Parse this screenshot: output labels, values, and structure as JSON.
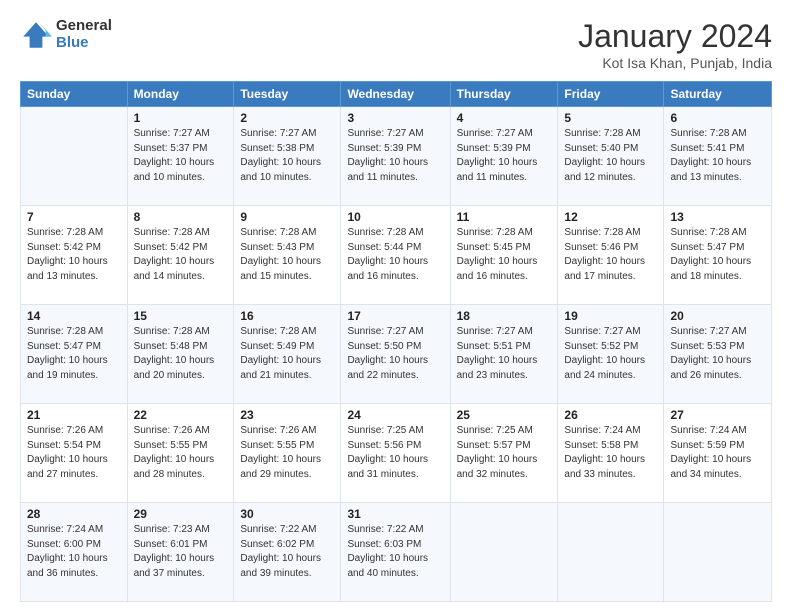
{
  "logo": {
    "general": "General",
    "blue": "Blue"
  },
  "header": {
    "month": "January 2024",
    "location": "Kot Isa Khan, Punjab, India"
  },
  "weekdays": [
    "Sunday",
    "Monday",
    "Tuesday",
    "Wednesday",
    "Thursday",
    "Friday",
    "Saturday"
  ],
  "weeks": [
    [
      {
        "day": "",
        "info": ""
      },
      {
        "day": "1",
        "info": "Sunrise: 7:27 AM\nSunset: 5:37 PM\nDaylight: 10 hours\nand 10 minutes."
      },
      {
        "day": "2",
        "info": "Sunrise: 7:27 AM\nSunset: 5:38 PM\nDaylight: 10 hours\nand 10 minutes."
      },
      {
        "day": "3",
        "info": "Sunrise: 7:27 AM\nSunset: 5:39 PM\nDaylight: 10 hours\nand 11 minutes."
      },
      {
        "day": "4",
        "info": "Sunrise: 7:27 AM\nSunset: 5:39 PM\nDaylight: 10 hours\nand 11 minutes."
      },
      {
        "day": "5",
        "info": "Sunrise: 7:28 AM\nSunset: 5:40 PM\nDaylight: 10 hours\nand 12 minutes."
      },
      {
        "day": "6",
        "info": "Sunrise: 7:28 AM\nSunset: 5:41 PM\nDaylight: 10 hours\nand 13 minutes."
      }
    ],
    [
      {
        "day": "7",
        "info": "Sunrise: 7:28 AM\nSunset: 5:42 PM\nDaylight: 10 hours\nand 13 minutes."
      },
      {
        "day": "8",
        "info": "Sunrise: 7:28 AM\nSunset: 5:42 PM\nDaylight: 10 hours\nand 14 minutes."
      },
      {
        "day": "9",
        "info": "Sunrise: 7:28 AM\nSunset: 5:43 PM\nDaylight: 10 hours\nand 15 minutes."
      },
      {
        "day": "10",
        "info": "Sunrise: 7:28 AM\nSunset: 5:44 PM\nDaylight: 10 hours\nand 16 minutes."
      },
      {
        "day": "11",
        "info": "Sunrise: 7:28 AM\nSunset: 5:45 PM\nDaylight: 10 hours\nand 16 minutes."
      },
      {
        "day": "12",
        "info": "Sunrise: 7:28 AM\nSunset: 5:46 PM\nDaylight: 10 hours\nand 17 minutes."
      },
      {
        "day": "13",
        "info": "Sunrise: 7:28 AM\nSunset: 5:47 PM\nDaylight: 10 hours\nand 18 minutes."
      }
    ],
    [
      {
        "day": "14",
        "info": "Sunrise: 7:28 AM\nSunset: 5:47 PM\nDaylight: 10 hours\nand 19 minutes."
      },
      {
        "day": "15",
        "info": "Sunrise: 7:28 AM\nSunset: 5:48 PM\nDaylight: 10 hours\nand 20 minutes."
      },
      {
        "day": "16",
        "info": "Sunrise: 7:28 AM\nSunset: 5:49 PM\nDaylight: 10 hours\nand 21 minutes."
      },
      {
        "day": "17",
        "info": "Sunrise: 7:27 AM\nSunset: 5:50 PM\nDaylight: 10 hours\nand 22 minutes."
      },
      {
        "day": "18",
        "info": "Sunrise: 7:27 AM\nSunset: 5:51 PM\nDaylight: 10 hours\nand 23 minutes."
      },
      {
        "day": "19",
        "info": "Sunrise: 7:27 AM\nSunset: 5:52 PM\nDaylight: 10 hours\nand 24 minutes."
      },
      {
        "day": "20",
        "info": "Sunrise: 7:27 AM\nSunset: 5:53 PM\nDaylight: 10 hours\nand 26 minutes."
      }
    ],
    [
      {
        "day": "21",
        "info": "Sunrise: 7:26 AM\nSunset: 5:54 PM\nDaylight: 10 hours\nand 27 minutes."
      },
      {
        "day": "22",
        "info": "Sunrise: 7:26 AM\nSunset: 5:55 PM\nDaylight: 10 hours\nand 28 minutes."
      },
      {
        "day": "23",
        "info": "Sunrise: 7:26 AM\nSunset: 5:55 PM\nDaylight: 10 hours\nand 29 minutes."
      },
      {
        "day": "24",
        "info": "Sunrise: 7:25 AM\nSunset: 5:56 PM\nDaylight: 10 hours\nand 31 minutes."
      },
      {
        "day": "25",
        "info": "Sunrise: 7:25 AM\nSunset: 5:57 PM\nDaylight: 10 hours\nand 32 minutes."
      },
      {
        "day": "26",
        "info": "Sunrise: 7:24 AM\nSunset: 5:58 PM\nDaylight: 10 hours\nand 33 minutes."
      },
      {
        "day": "27",
        "info": "Sunrise: 7:24 AM\nSunset: 5:59 PM\nDaylight: 10 hours\nand 34 minutes."
      }
    ],
    [
      {
        "day": "28",
        "info": "Sunrise: 7:24 AM\nSunset: 6:00 PM\nDaylight: 10 hours\nand 36 minutes."
      },
      {
        "day": "29",
        "info": "Sunrise: 7:23 AM\nSunset: 6:01 PM\nDaylight: 10 hours\nand 37 minutes."
      },
      {
        "day": "30",
        "info": "Sunrise: 7:22 AM\nSunset: 6:02 PM\nDaylight: 10 hours\nand 39 minutes."
      },
      {
        "day": "31",
        "info": "Sunrise: 7:22 AM\nSunset: 6:03 PM\nDaylight: 10 hours\nand 40 minutes."
      },
      {
        "day": "",
        "info": ""
      },
      {
        "day": "",
        "info": ""
      },
      {
        "day": "",
        "info": ""
      }
    ]
  ]
}
